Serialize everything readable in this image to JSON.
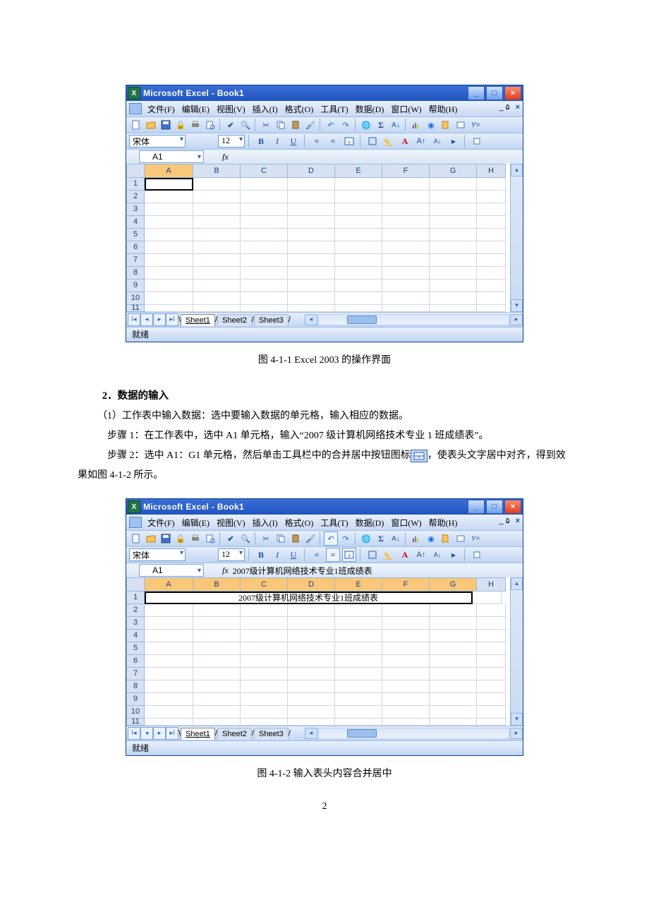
{
  "page_number": "2",
  "caption1": "图 4-1-1 Excel 2003 的操作界面",
  "caption2": "图 4-1-2 输入表头内容合并居中",
  "doc": {
    "heading": "2．数据的输入",
    "p1": "（1）工作表中输入数据：选中要输入数据的单元格，输入相应的数据。",
    "p2": "步骤 1：在工作表中，选中 A1 单元格，输入“2007 级计算机网络技术专业 1 班成绩表”。",
    "p3a": "步骤 2：选中 A1：G1 单元格，然后单击工具栏中的合并居中按钮图标",
    "p3b": "，使表头文字居中对齐，得到效果如图 4-1-2 所示。"
  },
  "excel": {
    "title": "Microsoft Excel - Book1",
    "menus": [
      "文件(F)",
      "编辑(E)",
      "视图(V)",
      "插入(I)",
      "格式(O)",
      "工具(T)",
      "数据(D)",
      "窗口(W)",
      "帮助(H)"
    ],
    "font_name": "宋体",
    "font_size": "12",
    "status": "就绪",
    "sheets": [
      "Sheet1",
      "Sheet2",
      "Sheet3"
    ],
    "cols": [
      "A",
      "B",
      "C",
      "D",
      "E",
      "F",
      "G",
      "H"
    ],
    "rows": [
      "1",
      "2",
      "3",
      "4",
      "5",
      "6",
      "7",
      "8",
      "9",
      "10",
      "11"
    ]
  },
  "shot1": {
    "active_cell": "A1",
    "formula_value": ""
  },
  "shot2": {
    "active_cell": "A1",
    "formula_value": "2007级计算机网络技术专业1班成绩表",
    "merged_text": "2007级计算机网络技术专业1班成绩表"
  }
}
